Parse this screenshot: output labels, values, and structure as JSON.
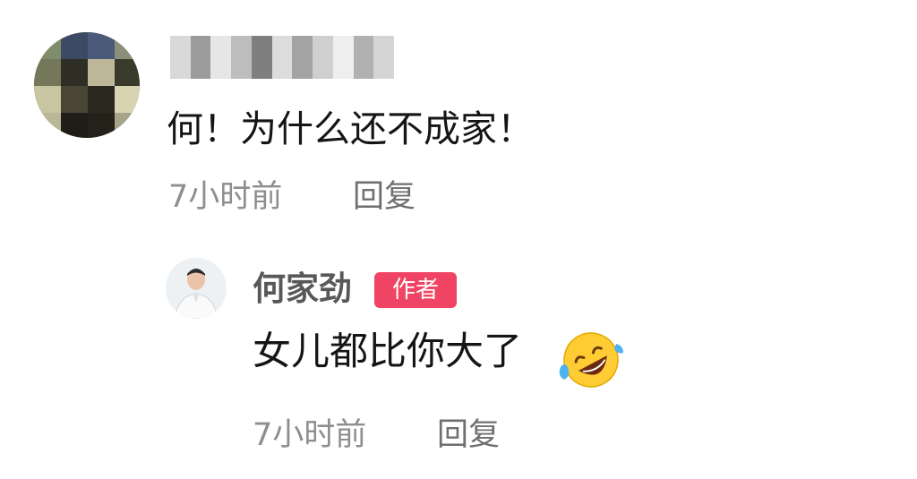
{
  "comment": {
    "text": "何！为什么还不成家！",
    "time": "7小时前",
    "reply_label": "回复"
  },
  "reply": {
    "author_name": "何家劲",
    "author_badge": "作者",
    "text": "女儿都比你大了",
    "emoji": "rolling-on-floor-laughing-emoji",
    "time": "7小时前",
    "reply_label": "回复"
  },
  "colors": {
    "badge": "#ef4463",
    "text": "#151515",
    "meta": "#8e8e8e"
  }
}
